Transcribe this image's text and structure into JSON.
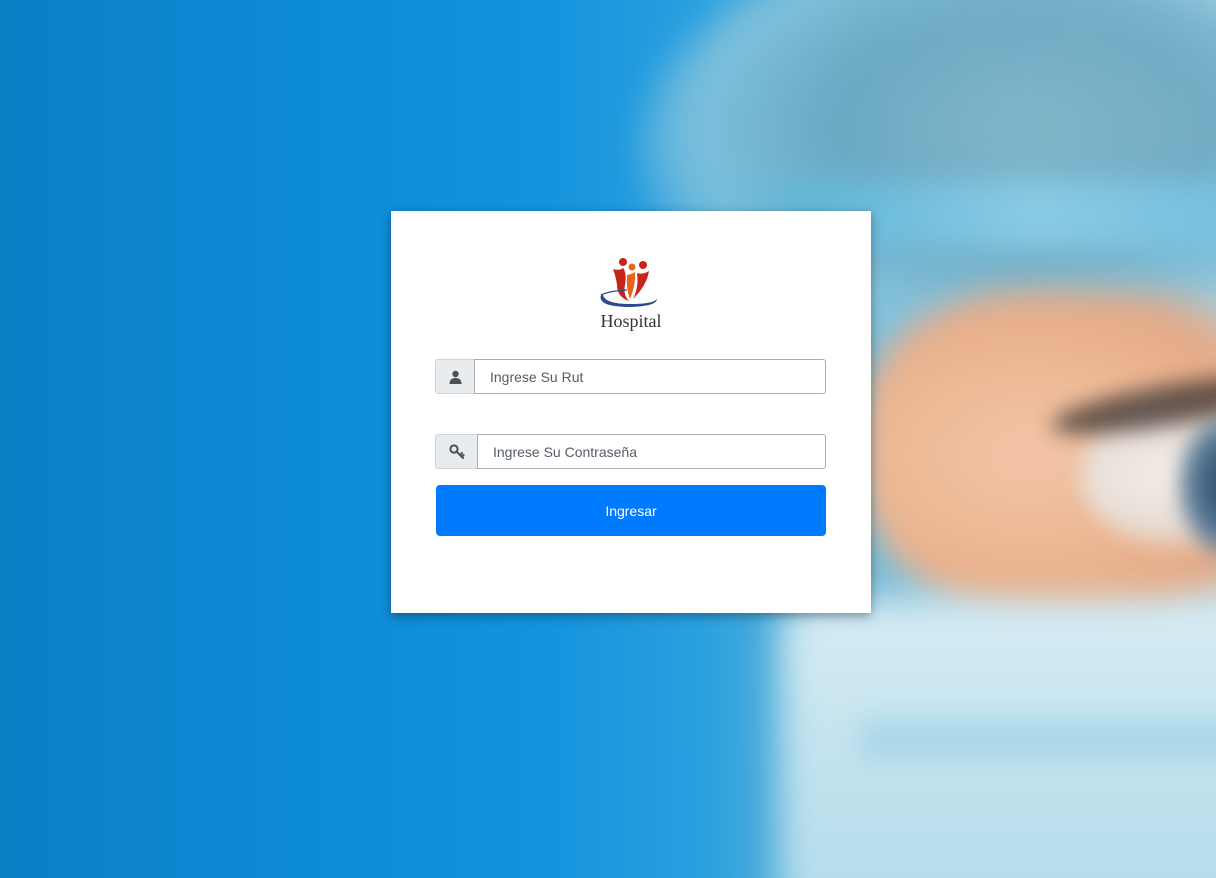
{
  "page": {
    "background": "blurred-surgeon-eye-photo"
  },
  "login": {
    "logo_text": "Hospital",
    "rut_field": {
      "placeholder": "Ingrese Su Rut",
      "value": "",
      "icon": "user-icon"
    },
    "password_field": {
      "placeholder": "Ingrese Su Contraseña",
      "value": "",
      "icon": "key-icon"
    },
    "submit_label": "Ingresar"
  },
  "colors": {
    "primary_button": "#007bff",
    "card_background": "#ffffff",
    "addon_background": "#e9ecef",
    "logo_red": "#c8241c",
    "logo_orange": "#e8641e",
    "logo_blue": "#2b4b8c"
  }
}
